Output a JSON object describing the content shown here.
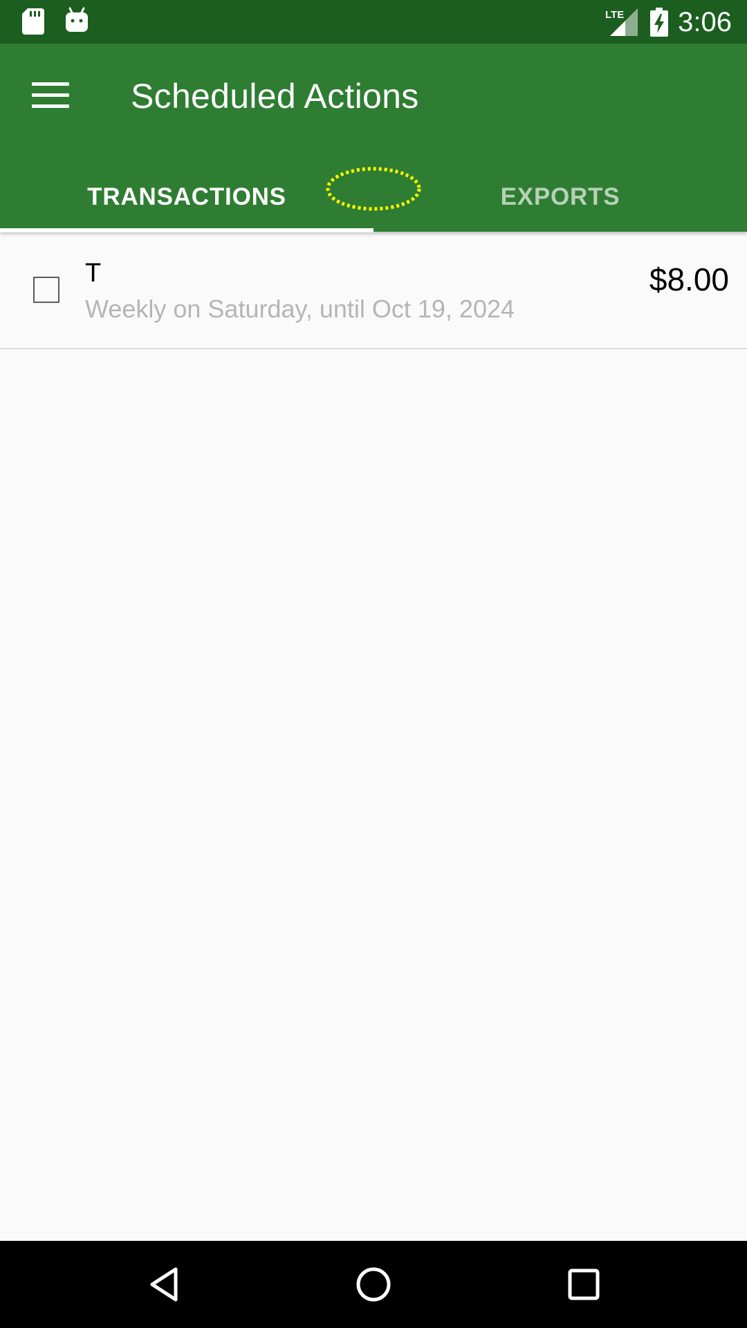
{
  "status_bar": {
    "time": "3:06",
    "network": "LTE",
    "icons": [
      "sd-card-icon",
      "android-icon",
      "lte-signal-icon",
      "battery-charging-icon"
    ]
  },
  "app_bar": {
    "title": "Scheduled Actions",
    "menu_icon": "hamburger-menu-icon",
    "background_color": "#2e7d32",
    "status_bar_color": "#1b5e20"
  },
  "tabs": [
    {
      "label": "TRANSACTIONS",
      "selected": true
    },
    {
      "label": "EXPORTS",
      "selected": false
    }
  ],
  "scheduled_transactions": [
    {
      "name": "T",
      "schedule": "Weekly on Saturday, until Oct 19, 2024",
      "amount": "$8.00",
      "checked": false
    }
  ],
  "nav_bar": {
    "buttons": [
      "back-icon",
      "home-icon",
      "recents-icon"
    ]
  }
}
